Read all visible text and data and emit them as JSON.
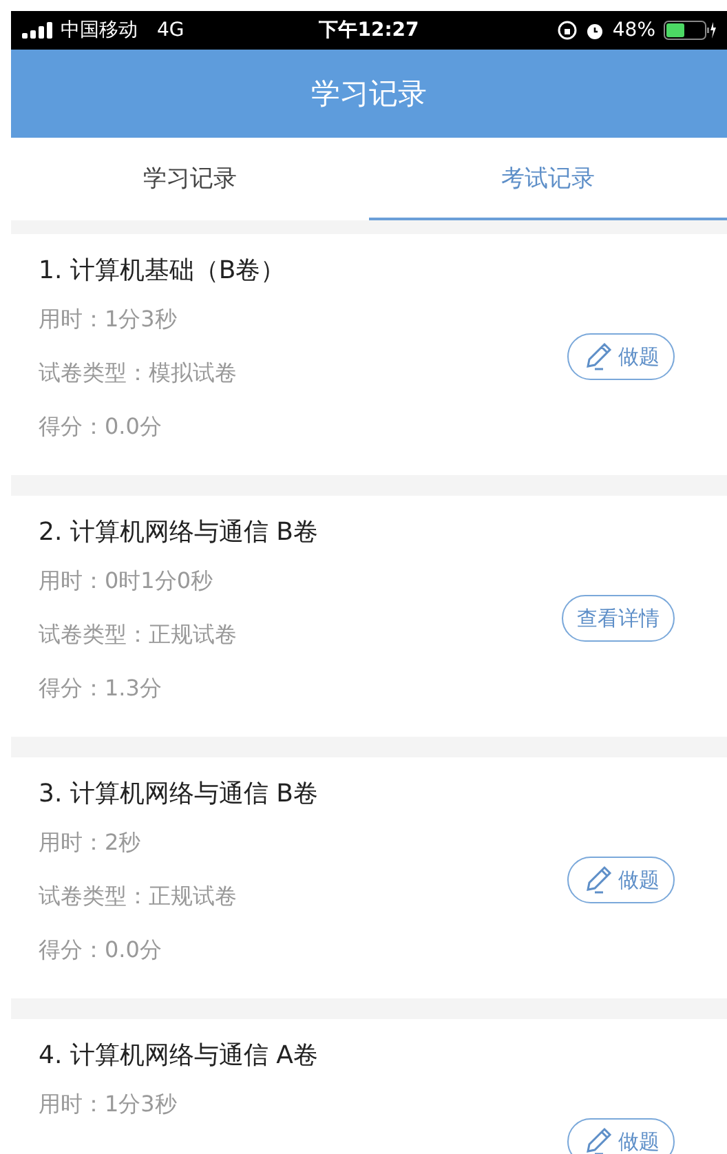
{
  "status_bar": {
    "carrier": "中国移动",
    "network": "4G",
    "time": "下午12:27",
    "battery": "48%"
  },
  "header": {
    "title": "学习记录"
  },
  "tabs": [
    {
      "label": "学习记录",
      "selected": false
    },
    {
      "label": "考试记录",
      "selected": true
    }
  ],
  "records": [
    {
      "title": "1. 计算机基础（B卷）",
      "lines": [
        "用时：1分3秒",
        "试卷类型：模拟试卷",
        "得分：0.0分"
      ],
      "action": {
        "kind": "practice",
        "label": "做题"
      }
    },
    {
      "title": "2. 计算机网络与通信 B卷",
      "lines": [
        "用时：0时1分0秒",
        "试卷类型：正规试卷",
        "得分：1.3分"
      ],
      "action": {
        "kind": "detail",
        "label": "查看详情"
      }
    },
    {
      "title": "3. 计算机网络与通信 B卷",
      "lines": [
        "用时：2秒",
        "试卷类型：正规试卷",
        "得分：0.0分"
      ],
      "action": {
        "kind": "practice",
        "label": "做题"
      }
    },
    {
      "title": "4. 计算机网络与通信 A卷",
      "lines": [
        "用时：1分3秒"
      ],
      "action": {
        "kind": "practice",
        "label": "做题"
      }
    }
  ]
}
